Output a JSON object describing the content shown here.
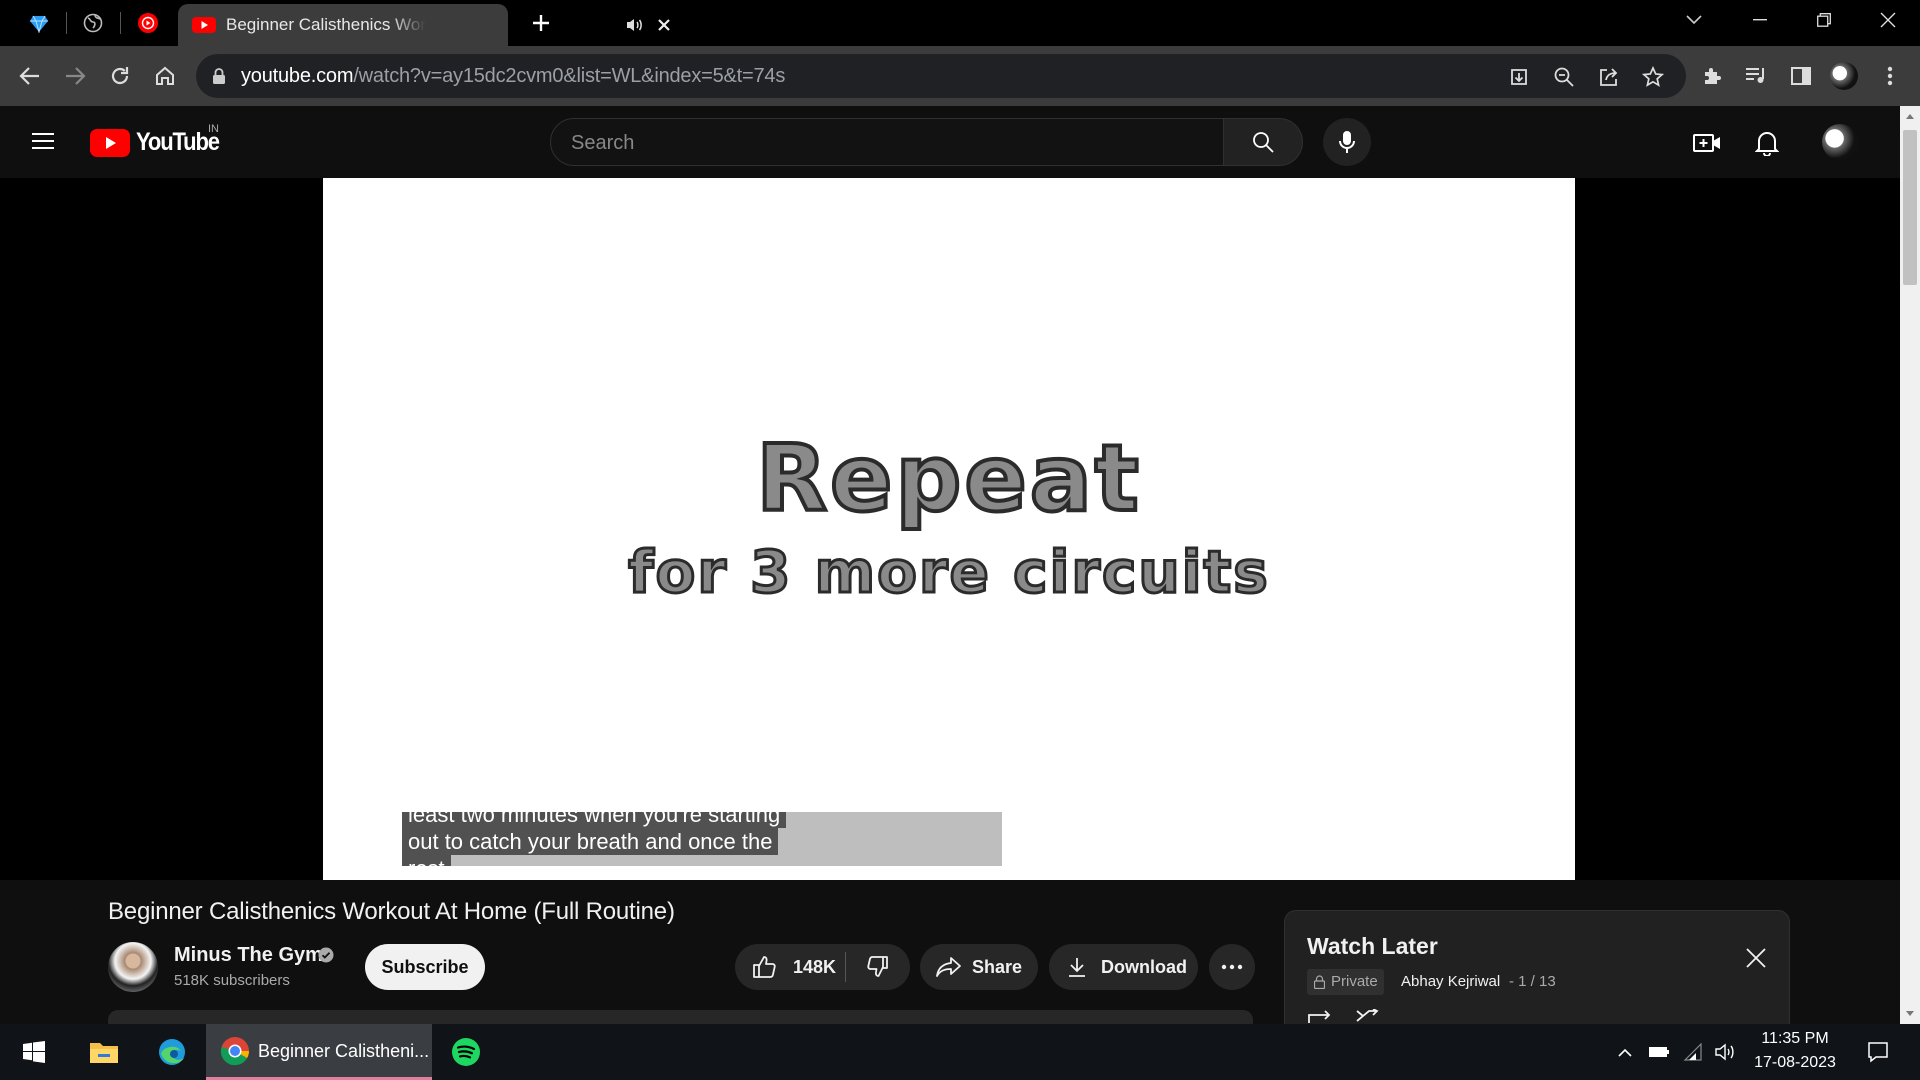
{
  "browser": {
    "pinned_tabs": [
      {
        "icon": "gem-icon"
      },
      {
        "icon": "globe-icon"
      },
      {
        "icon": "youtube-music-icon"
      }
    ],
    "active_tab": {
      "title": "Beginner Calisthenics Workout At Home (Full Routine)",
      "icon": "youtube-icon",
      "audio": "audio-playing-icon"
    },
    "new_tab_icon": "plus-icon",
    "url_host": "youtube.com",
    "url_path": "/watch?v=ay15dc2cvm0&list=WL&index=5&t=74s"
  },
  "youtube": {
    "logo_text": "YouTube",
    "region": "IN",
    "search_placeholder": "Search"
  },
  "video": {
    "overlay_title": "Repeat",
    "overlay_subtitle": "for 3 more circuits",
    "captions": [
      "least two minutes when you're starting",
      "out to catch your breath and once the",
      "rest"
    ],
    "title": "Beginner Calisthenics Workout At Home (Full Routine)",
    "channel": "Minus The Gym",
    "subscribers": "518K subscribers",
    "subscribe_label": "Subscribe",
    "likes": "148K",
    "share_label": "Share",
    "download_label": "Download"
  },
  "playlist": {
    "title": "Watch Later",
    "privacy": "Private",
    "owner": "Abhay Kejriwal",
    "index": "- 1 / 13"
  },
  "taskbar": {
    "chrome_label": "Beginner Calistheni...",
    "time": "11:35 PM",
    "date": "17-08-2023"
  },
  "colors": {
    "youtube_red": "#ff0000",
    "dark_bg": "#0f0f0f",
    "chrome_toolbar": "#3c3c3c"
  }
}
